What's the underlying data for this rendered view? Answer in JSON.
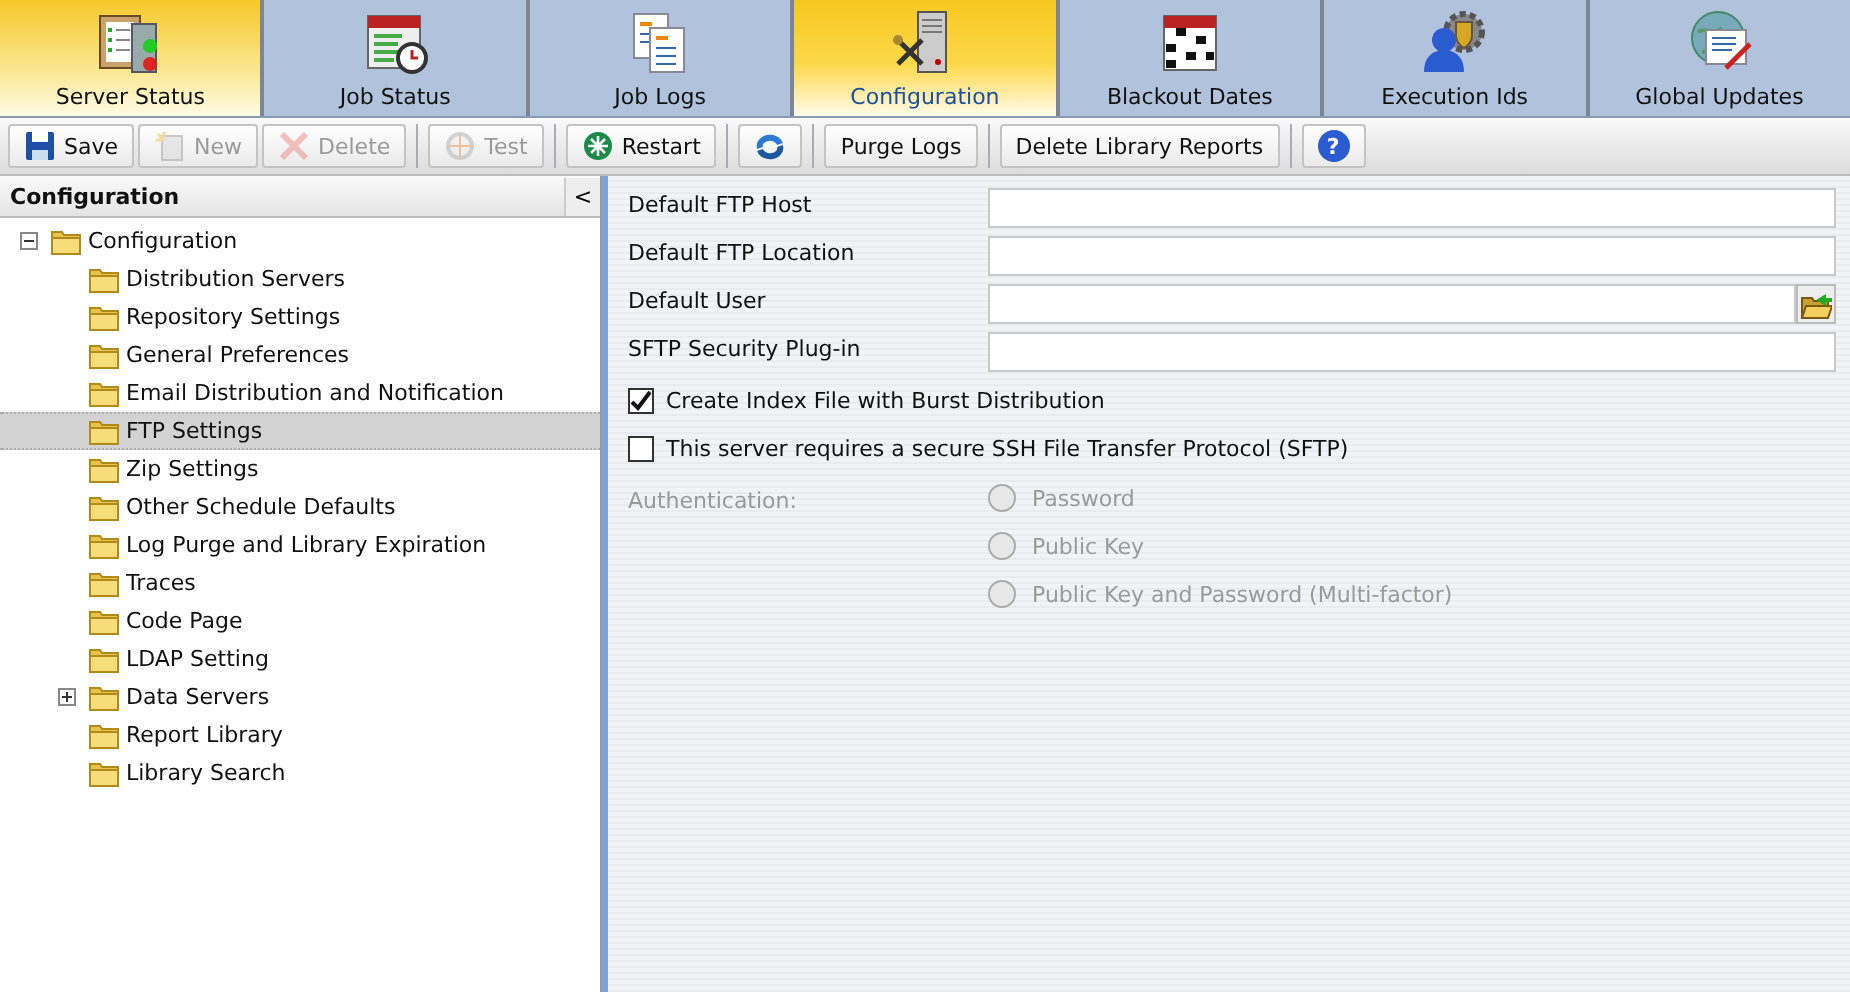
{
  "tabs": [
    {
      "label": "Server Status",
      "kind": "server-status",
      "selected": false,
      "hover": true
    },
    {
      "label": "Job Status",
      "kind": "calendar-clock",
      "selected": false,
      "hover": false
    },
    {
      "label": "Job Logs",
      "kind": "documents",
      "selected": false,
      "hover": false
    },
    {
      "label": "Configuration",
      "kind": "server-tools",
      "selected": true,
      "hover": false
    },
    {
      "label": "Blackout Dates",
      "kind": "calendar-grid",
      "selected": false,
      "hover": false
    },
    {
      "label": "Execution Ids",
      "kind": "person-gear",
      "selected": false,
      "hover": false
    },
    {
      "label": "Global Updates",
      "kind": "globe-document",
      "selected": false,
      "hover": false
    }
  ],
  "toolbar": [
    {
      "kind": "save",
      "label": "Save",
      "disabled": false
    },
    {
      "kind": "new",
      "label": "New",
      "disabled": true
    },
    {
      "kind": "delete",
      "label": "Delete",
      "disabled": true
    },
    {
      "kind": "test",
      "label": "Test",
      "disabled": true
    },
    {
      "kind": "restart",
      "label": "Restart",
      "disabled": false
    },
    {
      "kind": "refresh",
      "disabled": false
    },
    {
      "kind": "plain",
      "label": "Purge Logs",
      "disabled": false
    },
    {
      "kind": "plain",
      "label": "Delete Library Reports",
      "disabled": false
    },
    {
      "kind": "help",
      "symbol": "?",
      "disabled": false
    }
  ],
  "sidebar": {
    "title": "Configuration",
    "collapse": "<",
    "tree": [
      {
        "label": "Configuration",
        "expanded": true,
        "selected": false,
        "children": [
          {
            "label": "Distribution Servers",
            "selected": false
          },
          {
            "label": "Repository Settings",
            "selected": false
          },
          {
            "label": "General Preferences",
            "selected": false
          },
          {
            "label": "Email Distribution and Notification",
            "selected": false
          },
          {
            "label": "FTP Settings",
            "selected": true
          },
          {
            "label": "Zip Settings",
            "selected": false
          },
          {
            "label": "Other Schedule Defaults",
            "selected": false
          },
          {
            "label": "Log Purge and Library Expiration",
            "selected": false
          },
          {
            "label": "Traces",
            "selected": false
          },
          {
            "label": "Code Page",
            "selected": false
          },
          {
            "label": "LDAP Setting",
            "selected": false
          },
          {
            "label": "Data Servers",
            "selected": false,
            "expanded": false
          },
          {
            "label": "Report Library",
            "selected": false
          },
          {
            "label": "Library Search",
            "selected": false
          }
        ]
      }
    ]
  },
  "form": {
    "fields": [
      {
        "kind": "text",
        "label": "Default FTP Host"
      },
      {
        "kind": "text",
        "label": "Default FTP Location"
      },
      {
        "kind": "browse",
        "label": "Default User"
      },
      {
        "kind": "text",
        "label": "SFTP Security Plug-in"
      },
      {
        "kind": "checkbox",
        "label": "Create Index File with Burst Distribution",
        "checked": true
      },
      {
        "kind": "checkbox",
        "label": "This server requires a secure SSH File Transfer Protocol (SFTP)",
        "checked": false
      }
    ],
    "authentication": {
      "label": "Authentication:",
      "disabled": true,
      "options": [
        {
          "label": "Password",
          "selected": false
        },
        {
          "label": "Public Key",
          "selected": false
        },
        {
          "label": "Public Key and Password (Multi-factor)",
          "selected": false
        }
      ]
    }
  }
}
